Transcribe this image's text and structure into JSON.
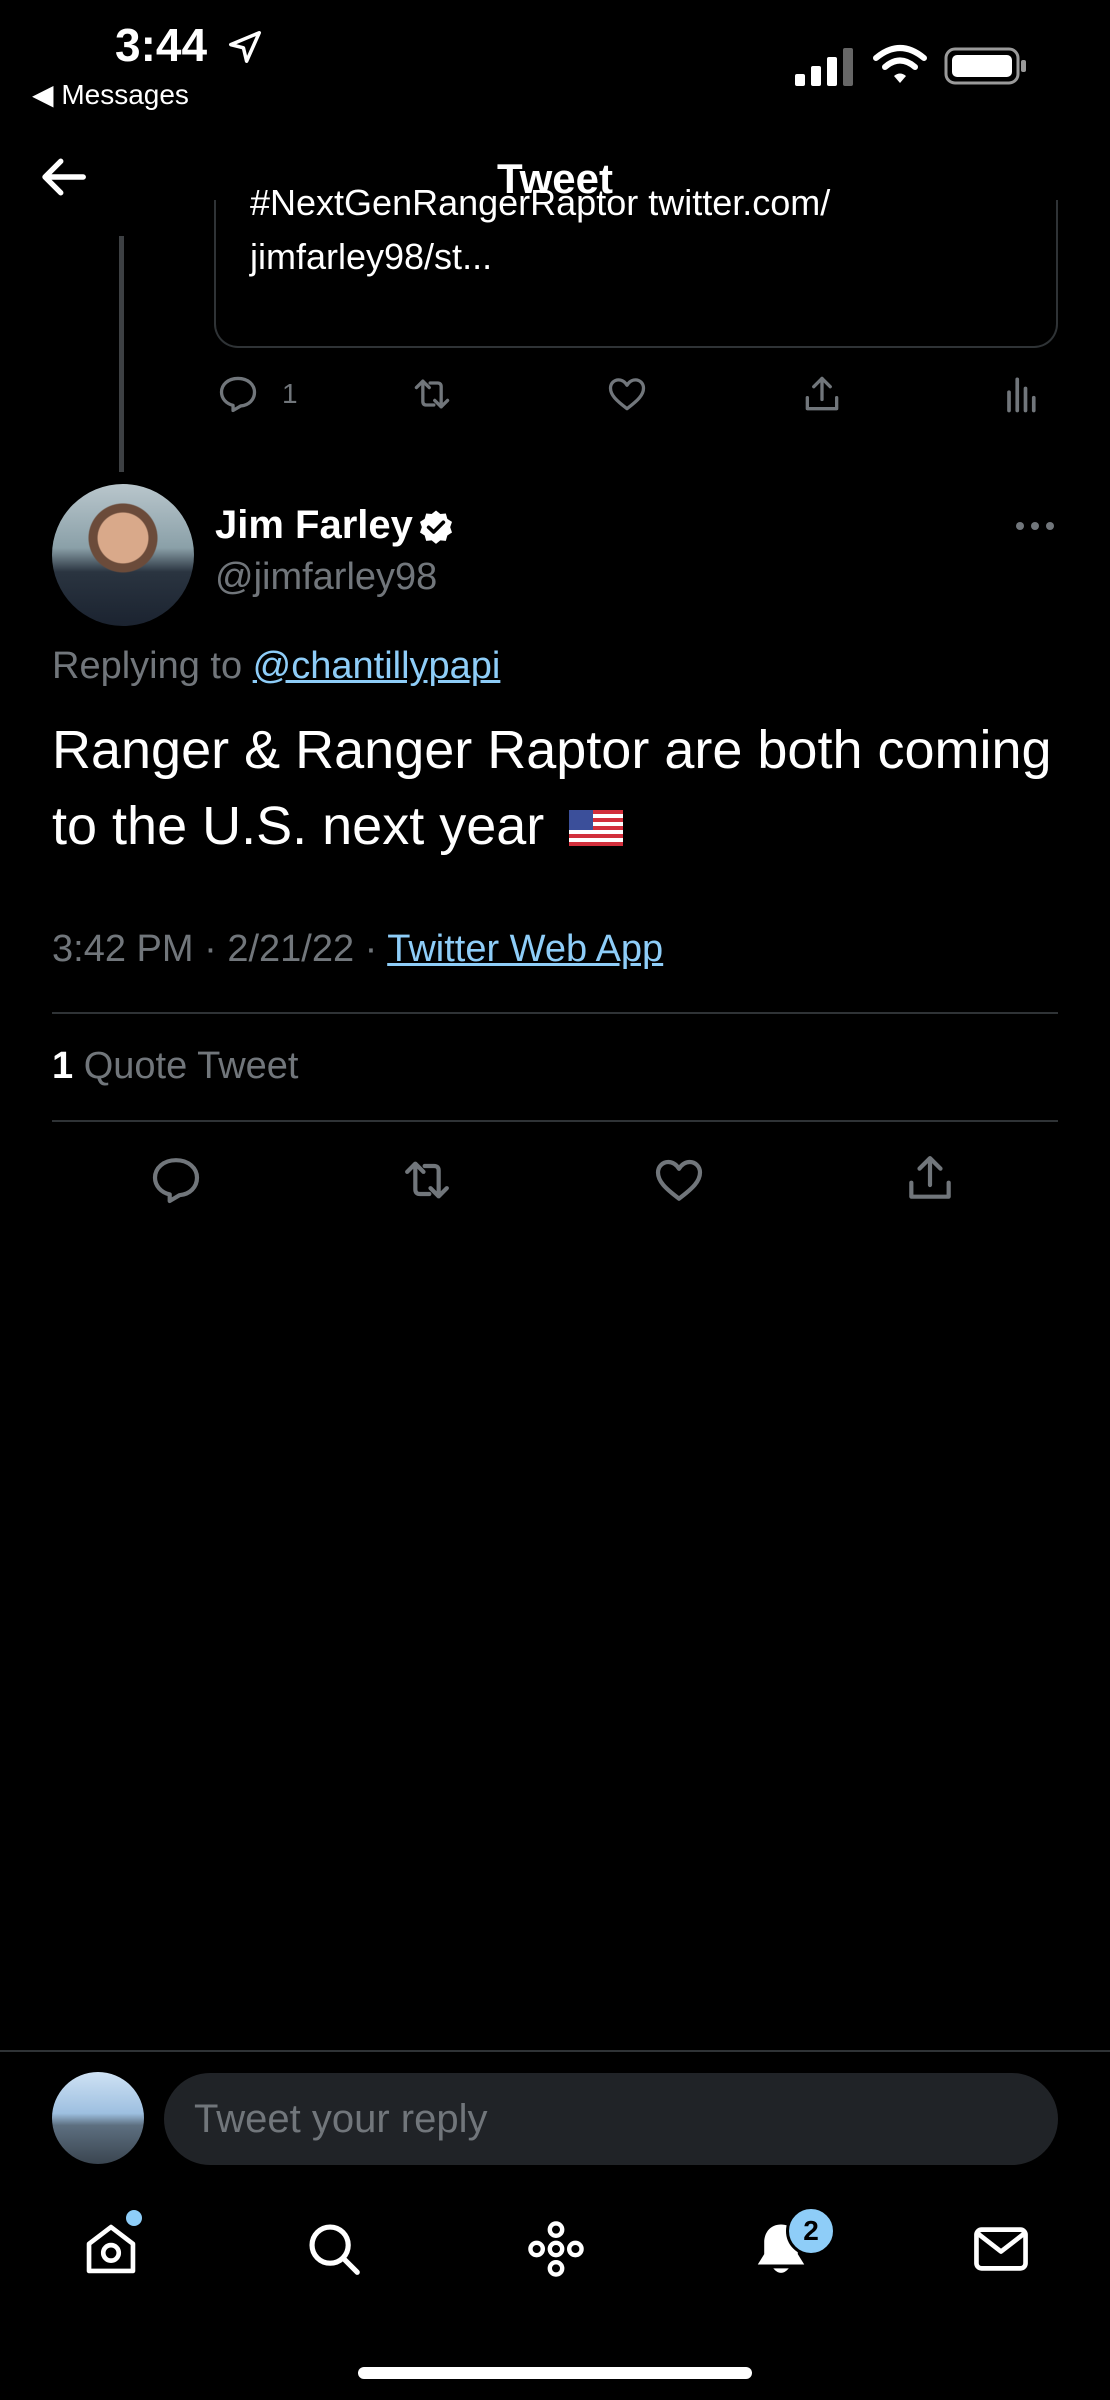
{
  "status_bar": {
    "time": "3:44",
    "back_app": "◀ Messages"
  },
  "header": {
    "title": "Tweet"
  },
  "previous_tweet": {
    "text_line1": "#NextGenRangerRaptor twitter.com/",
    "text_line2": "jimfarley98/st...",
    "reply_count": "1"
  },
  "tweet": {
    "author_name": "Jim Farley",
    "author_handle": "@jimfarley98",
    "replying_prefix": "Replying to ",
    "replying_to": "@chantillypapi",
    "text": "Ranger & Ranger Raptor are both coming to the U.S. next year",
    "time": "3:42 PM",
    "date": "2/21/22",
    "source": "Twitter Web App",
    "quote_count": "1",
    "quote_label": " Quote Tweet"
  },
  "reply_bar": {
    "placeholder": "Tweet your reply"
  },
  "tab_bar": {
    "notifications_badge": "2"
  },
  "colors": {
    "background": "#000000",
    "accent": "#8ecdf8",
    "muted": "#71767b",
    "divider": "#2f3336"
  },
  "icons": [
    "location-arrow-icon",
    "signal-icon",
    "wifi-icon",
    "battery-icon",
    "back-arrow-icon",
    "reply-icon",
    "retweet-icon",
    "like-icon",
    "share-icon",
    "analytics-icon",
    "verified-icon",
    "more-icon",
    "home-icon",
    "search-icon",
    "spaces-icon",
    "bell-icon",
    "mail-icon"
  ]
}
